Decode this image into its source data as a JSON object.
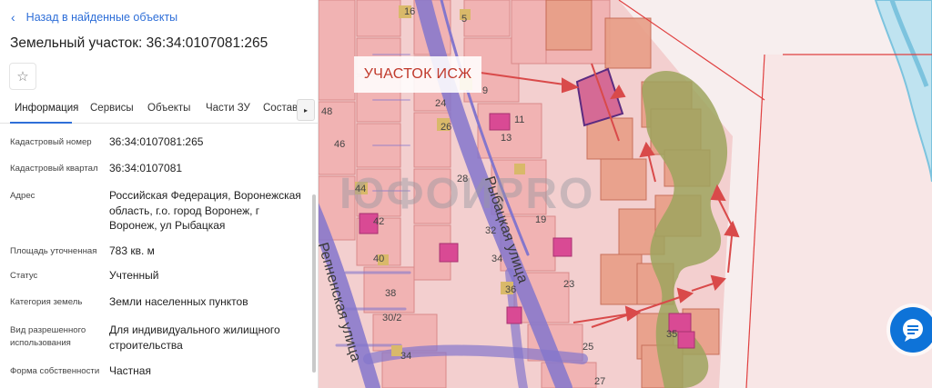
{
  "nav": {
    "back_label": "Назад в найденные объекты"
  },
  "header": {
    "title": "Земельный участок: 36:34:0107081:265"
  },
  "tabs": [
    {
      "label": "Информация",
      "active": true
    },
    {
      "label": "Сервисы",
      "active": false
    },
    {
      "label": "Объекты",
      "active": false
    },
    {
      "label": "Части ЗУ",
      "active": false
    },
    {
      "label": "Состав",
      "active": false
    }
  ],
  "fields": [
    {
      "label": "Кадастровый номер",
      "value": "36:34:0107081:265"
    },
    {
      "label": "Кадастровый квартал",
      "value": "36:34:0107081"
    },
    {
      "label": "Адрес",
      "value": "Российская Федерация, Воронежская область, г.о. город Воронеж, г Воронеж, ул Рыбацкая"
    },
    {
      "label": "Площадь уточненная",
      "value": "783 кв. м"
    },
    {
      "label": "Статус",
      "value": "Учтенный"
    },
    {
      "label": "Категория земель",
      "value": "Земли населенных пунктов"
    },
    {
      "label": "Вид разрешенного использования",
      "value": "Для индивидуального жилищного строительства"
    },
    {
      "label": "Форма собственности",
      "value": "Частная"
    }
  ],
  "map": {
    "plot_label": "УЧАСТОК ИСЖ",
    "watermark": "ЮФОИPRO",
    "streets": {
      "rybatskaya": "Рыбацкая улица",
      "repnenskaya": "Репненская улица"
    },
    "house_numbers": [
      "16",
      "5",
      "9",
      "48",
      "24",
      "11",
      "46",
      "26",
      "13",
      "44",
      "28",
      "42",
      "32",
      "19",
      "40",
      "34",
      "38",
      "36",
      "23",
      "30/2",
      "34",
      "25",
      "27",
      "35"
    ],
    "colors": {
      "parcel": "#f5b9b9",
      "parcel_border": "#d98a8a",
      "selected_parcel": "#d56a95",
      "road": "#8476cc",
      "arrow": "#d94a4a",
      "forest": "#9ea45e"
    }
  }
}
